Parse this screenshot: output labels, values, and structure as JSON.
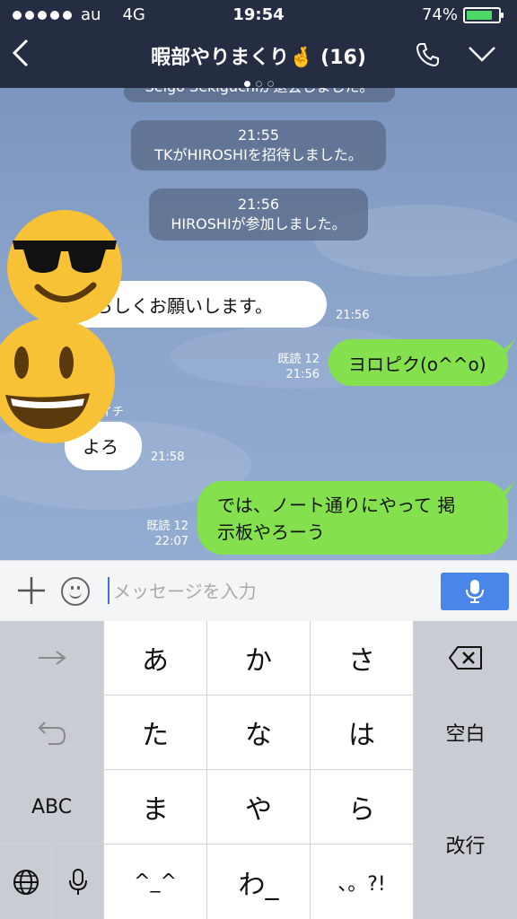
{
  "status_bar": {
    "carrier": "au",
    "network": "4G",
    "time": "19:54",
    "battery_percent": "74%",
    "battery_level": 0.74
  },
  "header": {
    "back_icon": "chevron-left-icon",
    "title": "暇部やりまくり🤞 (16)"
  },
  "chat": {
    "partial_top": "Seigo Sekiguchiが退会しました。",
    "system_messages": [
      {
        "time": "21:55",
        "text": "TKがHIROSHIを招待しました。"
      },
      {
        "time": "21:56",
        "text": "HIROSHIが参加しました。"
      }
    ],
    "messages": [
      {
        "side": "left",
        "text": "よろしくお願いします。",
        "time": "21:56"
      },
      {
        "side": "right",
        "text": "ヨロピク(o^^o)",
        "read": "既読 12",
        "time": "21:56"
      },
      {
        "side": "left",
        "sender": "ゆうイチ",
        "text": "よろ",
        "time": "21:58"
      },
      {
        "side": "right",
        "text_line1": "では、ノート通りにやって 掲",
        "text_line2": "示板やろーう",
        "read": "既読 12",
        "time": "22:07"
      }
    ]
  },
  "input": {
    "placeholder": "メッセージを入力"
  },
  "keyboard": {
    "row1": [
      "→",
      "あ",
      "か",
      "さ",
      "⌫"
    ],
    "row2": [
      "↩",
      "た",
      "な",
      "は",
      "空白"
    ],
    "row3": [
      "ABC",
      "ま",
      "や",
      "ら",
      "改行"
    ],
    "row4": [
      "🌐",
      "🎤",
      "^_^",
      "わ_",
      "、。?!"
    ]
  },
  "colors": {
    "header_bg": "#252d42",
    "bubble_right": "#84e04c",
    "send_button": "#4a86e8"
  }
}
